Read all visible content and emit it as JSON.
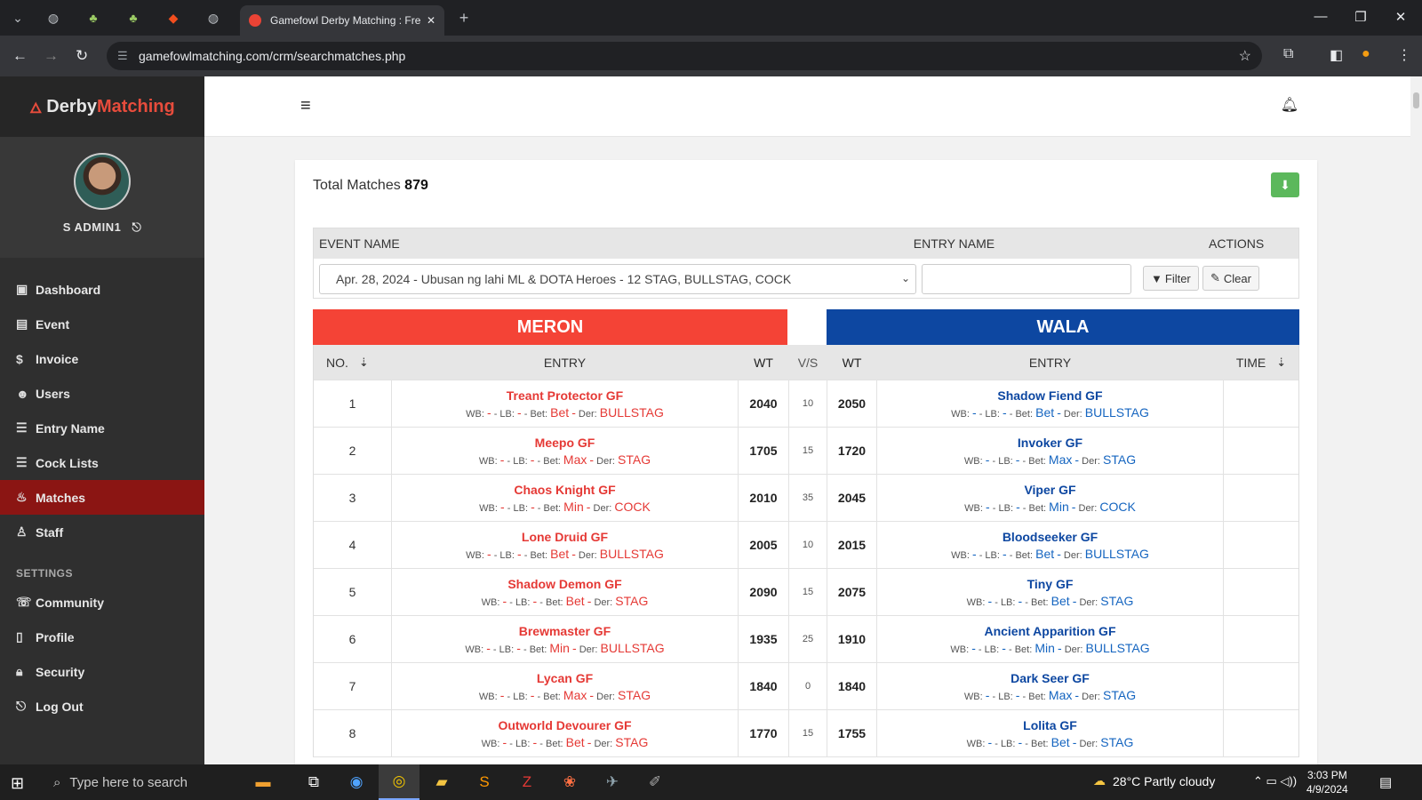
{
  "browser": {
    "tab_title": "Gamefowl Derby Matching : Fre",
    "url": "gamefowlmatching.com/crm/searchmatches.php"
  },
  "sidebar": {
    "brand_part1": "Derby",
    "brand_part2": "Matching",
    "user_name": "S ADMIN1",
    "menu": [
      "Dashboard",
      "Event",
      "Invoice",
      "Users",
      "Entry Name",
      "Cock Lists",
      "Matches",
      "Staff"
    ],
    "active_item": "Matches",
    "settings_title": "SETTINGS",
    "settings_menu": [
      "Community",
      "Profile",
      "Security",
      "Log Out"
    ]
  },
  "main": {
    "total_label": "Total Matches",
    "total_value": "879",
    "filters": {
      "event_header": "EVENT NAME",
      "entry_header": "ENTRY NAME",
      "actions_header": "ACTIONS",
      "event_selected": "Apr. 28, 2024 - Ubusan ng lahi ML & DOTA Heroes - 12 STAG, BULLSTAG, COCK",
      "entry_value": "",
      "filter_label": "Filter",
      "clear_label": "Clear"
    },
    "meron_label": "MERON",
    "wala_label": "WALA",
    "columns": {
      "no": "NO.",
      "entry": "ENTRY",
      "wt": "WT",
      "vs": "V/S",
      "time": "TIME"
    },
    "detail_labels": {
      "wb": "WB:",
      "lb": "LB:",
      "bet": "Bet:",
      "der": "Der:",
      "dash": "-"
    },
    "matches": [
      {
        "no": "1",
        "meron": {
          "name": "Treant Protector GF",
          "bet": "Bet",
          "der": "BULLSTAG",
          "wt": "2040"
        },
        "vs": "10",
        "wala": {
          "name": "Shadow Fiend GF",
          "bet": "Bet",
          "der": "BULLSTAG",
          "wt": "2050"
        }
      },
      {
        "no": "2",
        "meron": {
          "name": "Meepo GF",
          "bet": "Max",
          "der": "STAG",
          "wt": "1705"
        },
        "vs": "15",
        "wala": {
          "name": "Invoker GF",
          "bet": "Max",
          "der": "STAG",
          "wt": "1720"
        }
      },
      {
        "no": "3",
        "meron": {
          "name": "Chaos Knight GF",
          "bet": "Min",
          "der": "COCK",
          "wt": "2010"
        },
        "vs": "35",
        "wala": {
          "name": "Viper GF",
          "bet": "Min",
          "der": "COCK",
          "wt": "2045"
        }
      },
      {
        "no": "4",
        "meron": {
          "name": "Lone Druid GF",
          "bet": "Bet",
          "der": "BULLSTAG",
          "wt": "2005"
        },
        "vs": "10",
        "wala": {
          "name": "Bloodseeker GF",
          "bet": "Bet",
          "der": "BULLSTAG",
          "wt": "2015"
        }
      },
      {
        "no": "5",
        "meron": {
          "name": "Shadow Demon GF",
          "bet": "Bet",
          "der": "STAG",
          "wt": "2090"
        },
        "vs": "15",
        "wala": {
          "name": "Tiny GF",
          "bet": "Bet",
          "der": "STAG",
          "wt": "2075"
        }
      },
      {
        "no": "6",
        "meron": {
          "name": "Brewmaster GF",
          "bet": "Min",
          "der": "BULLSTAG",
          "wt": "1935"
        },
        "vs": "25",
        "wala": {
          "name": "Ancient Apparition GF",
          "bet": "Min",
          "der": "BULLSTAG",
          "wt": "1910"
        }
      },
      {
        "no": "7",
        "meron": {
          "name": "Lycan GF",
          "bet": "Max",
          "der": "STAG",
          "wt": "1840"
        },
        "vs": "0",
        "wala": {
          "name": "Dark Seer GF",
          "bet": "Max",
          "der": "STAG",
          "wt": "1840"
        }
      },
      {
        "no": "8",
        "meron": {
          "name": "Outworld Devourer GF",
          "bet": "Bet",
          "der": "STAG",
          "wt": "1770"
        },
        "vs": "15",
        "wala": {
          "name": "Lolita GF",
          "bet": "Bet",
          "der": "STAG",
          "wt": "1755"
        }
      }
    ]
  },
  "taskbar": {
    "search_placeholder": "Type here to search",
    "weather": "28°C  Partly cloudy",
    "time": "3:03 PM",
    "date": "4/9/2024"
  },
  "colors": {
    "meron": "#f44336",
    "wala": "#0d47a1",
    "active_menu": "#8b1513"
  }
}
